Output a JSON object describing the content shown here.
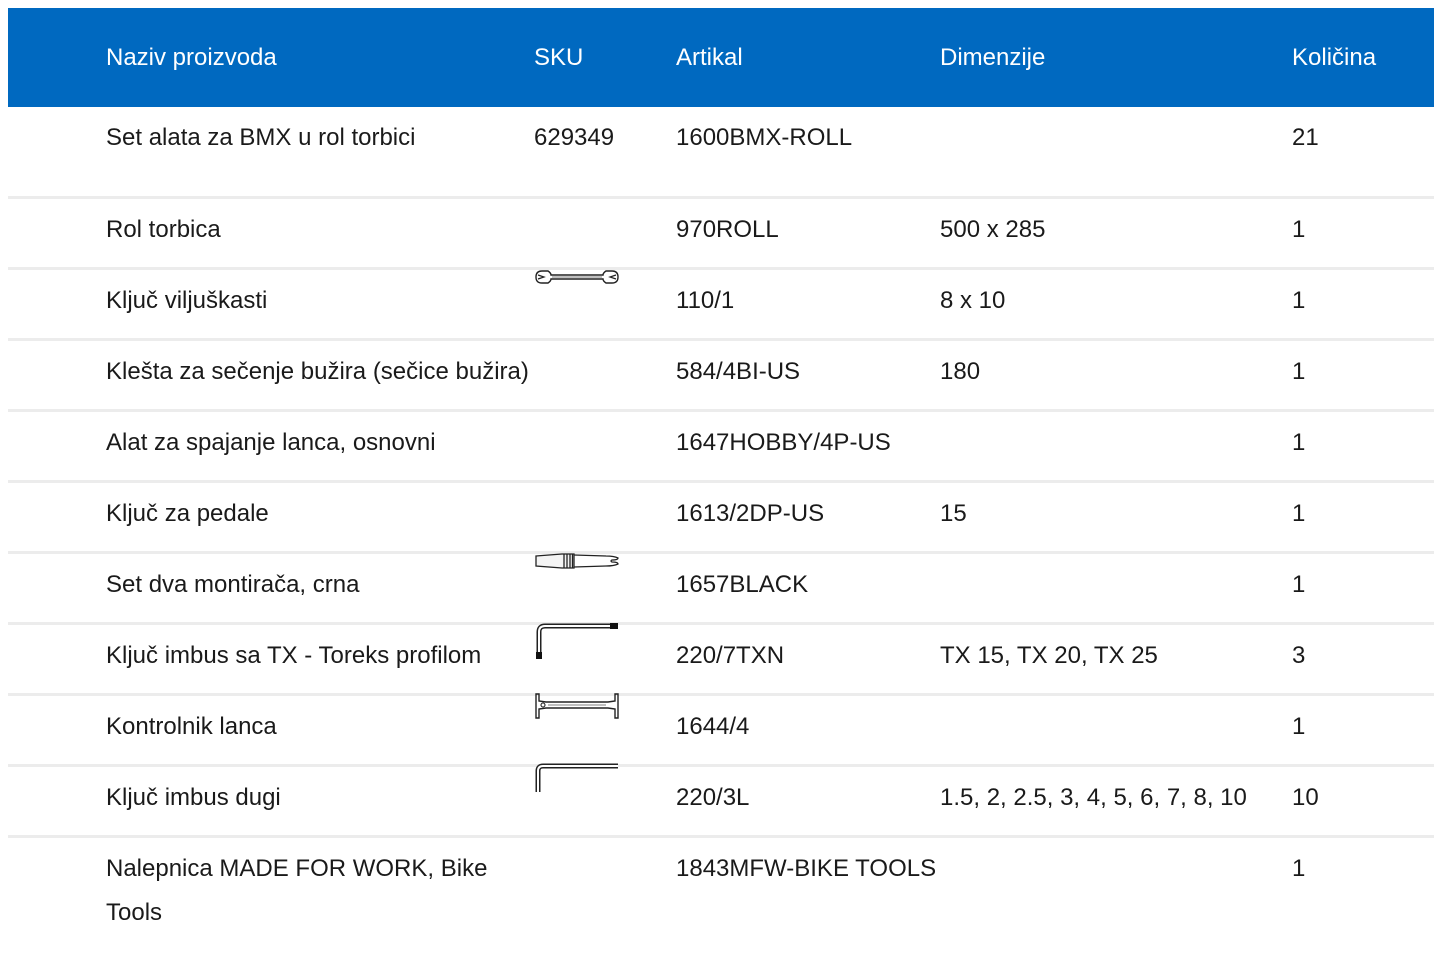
{
  "table": {
    "headers": {
      "name": "Naziv proizvoda",
      "sku": "SKU",
      "article": "Artikal",
      "dimensions": "Dimenzije",
      "quantity": "Količina"
    },
    "rows": [
      {
        "name": "Set alata za BMX u rol torbici",
        "sku": "629349",
        "article": "1600BMX-ROLL",
        "dimensions": "",
        "quantity": "21",
        "icon": null
      },
      {
        "name": "Rol torbica",
        "sku": "",
        "article": "970ROLL",
        "dimensions": "500 x 285",
        "quantity": "1",
        "icon": null
      },
      {
        "name": "Ključ viljuškasti",
        "sku": "",
        "article": "110/1",
        "dimensions": "8 x 10",
        "quantity": "1",
        "icon": "open-end-wrench-icon"
      },
      {
        "name": "Klešta za sečenje bužira (sečice bužira)",
        "sku": "",
        "article": "584/4BI-US",
        "dimensions": "180",
        "quantity": "1",
        "icon": null
      },
      {
        "name": "Alat za spajanje lanca, osnovni",
        "sku": "",
        "article": "1647HOBBY/4P-US",
        "dimensions": "",
        "quantity": "1",
        "icon": null
      },
      {
        "name": "Ključ za pedale",
        "sku": "",
        "article": "1613/2DP-US",
        "dimensions": "15",
        "quantity": "1",
        "icon": null
      },
      {
        "name": "Set dva montirača, crna",
        "sku": "",
        "article": "1657BLACK",
        "dimensions": "",
        "quantity": "1",
        "icon": "tire-lever-icon"
      },
      {
        "name": "Ključ imbus sa TX - Toreks profilom",
        "sku": "",
        "article": "220/7TXN",
        "dimensions": "TX 15, TX 20, TX 25",
        "quantity": "3",
        "icon": "torx-key-icon"
      },
      {
        "name": "Kontrolnik lanca",
        "sku": "",
        "article": "1644/4",
        "dimensions": "",
        "quantity": "1",
        "icon": "chain-checker-icon"
      },
      {
        "name": "Ključ imbus dugi",
        "sku": "",
        "article": "220/3L",
        "dimensions": "1.5, 2, 2.5, 3, 4, 5, 6, 7, 8, 10",
        "quantity": "10",
        "icon": "hex-key-icon"
      },
      {
        "name": "Nalepnica MADE FOR WORK, Bike Tools",
        "sku": "",
        "article": "1843MFW-BIKE TOOLS",
        "dimensions": "",
        "quantity": "1",
        "icon": null
      }
    ]
  },
  "colors": {
    "header_background": "#0069c0",
    "header_text": "#ffffff",
    "row_divider": "#ececec"
  }
}
